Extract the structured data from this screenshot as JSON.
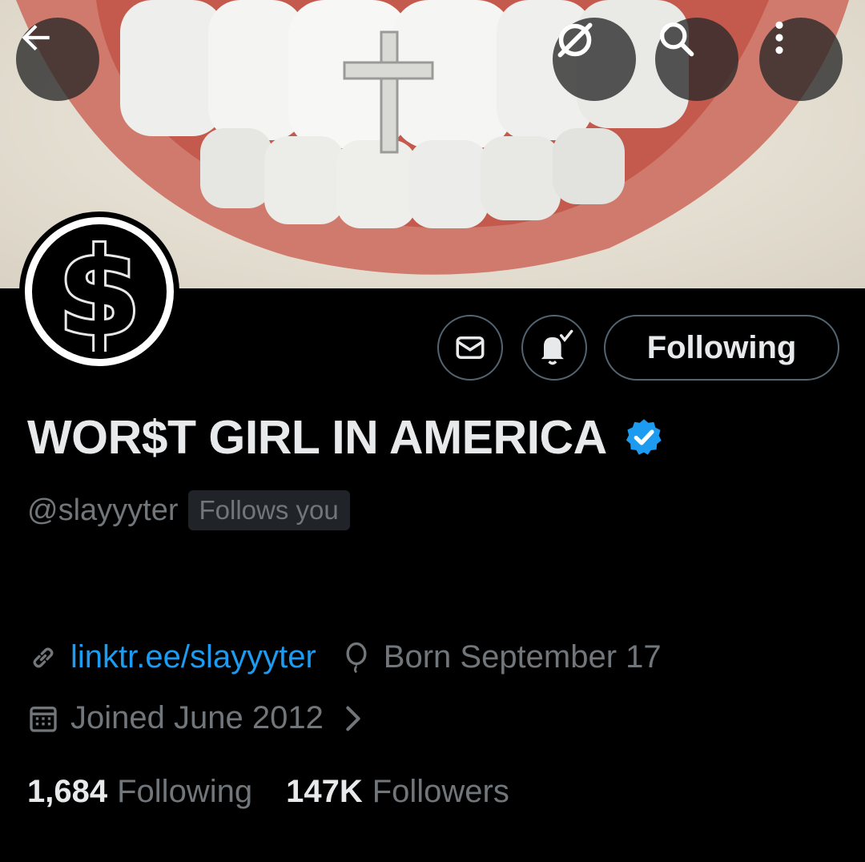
{
  "profile": {
    "display_name": "WOR$T GIRL IN AMERICA",
    "handle": "@slayyyter",
    "follows_you_badge": "Follows you",
    "link": "linktr.ee/slayyyter",
    "birthday": "Born September 17",
    "joined": "Joined June 2012",
    "verified": true
  },
  "actions": {
    "follow_label": "Following"
  },
  "stats": {
    "following_count": "1,684",
    "following_label": "Following",
    "followers_count": "147K",
    "followers_label": "Followers"
  },
  "icons": {
    "back": "arrow-left-icon",
    "grok": "grok-icon",
    "search": "search-icon",
    "more": "more-vertical-icon",
    "message": "envelope-icon",
    "notifications": "bell-check-icon",
    "link": "link-icon",
    "birthday": "balloon-icon",
    "calendar": "calendar-icon",
    "chevron": "chevron-right-icon"
  },
  "colors": {
    "background": "#000000",
    "text_primary": "#e7e9ea",
    "text_secondary": "#71767b",
    "link": "#1d9bf0",
    "verified": "#1d9bf0",
    "border": "#536471"
  },
  "avatar": {
    "glyph": "$"
  }
}
